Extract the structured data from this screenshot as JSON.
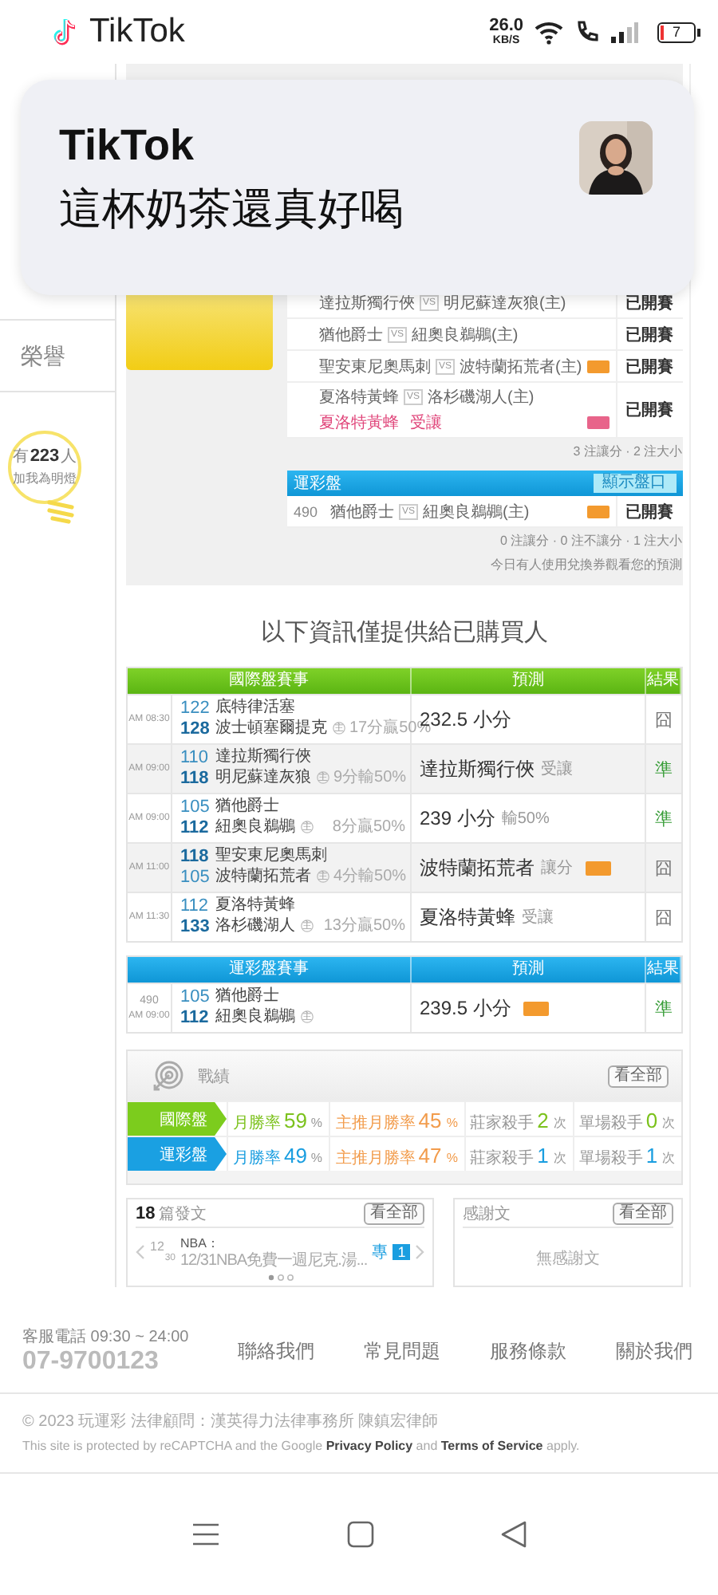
{
  "status_bar": {
    "app": "TikTok",
    "speed": "26.0",
    "speed_unit": "KB/S",
    "battery": "7"
  },
  "notification": {
    "title": "TikTok",
    "message": "這杯奶茶還真好喝"
  },
  "sidebar": {
    "items": [
      {
        "label": "榮譽"
      }
    ],
    "fans": {
      "prefix": "有",
      "count": "223",
      "suffix": "人",
      "caption": "加我為明燈"
    }
  },
  "picks": {
    "rows": [
      {
        "away": "達拉斯獨行俠",
        "vs": "VS",
        "home": "明尼蘇達灰狼(主)",
        "status": "已開賽"
      },
      {
        "away": "猶他爵士",
        "vs": "VS",
        "home": "紐奧良鵜鶘(主)",
        "status": "已開賽"
      },
      {
        "away": "聖安東尼奧馬刺",
        "vs": "VS",
        "home": "波特蘭拓荒者(主)",
        "badge": {
          "color": "#f39a2e"
        },
        "status": "已開賽"
      },
      {
        "away": "夏洛特黃蜂",
        "vs": "VS",
        "home": "洛杉磯湖人(主)",
        "pick": "夏洛特黃蜂",
        "pick_note": "受讓",
        "badge": {
          "color": "#e8648a"
        },
        "status": "已開賽"
      }
    ],
    "summary": "3 注讓分 · 2 注大小"
  },
  "lottery": {
    "title": "運彩盤",
    "button": "顯示盤口",
    "rows": [
      {
        "number": "490",
        "away": "猶他爵士",
        "vs": "VS",
        "home": "紐奧良鵜鶘(主)",
        "badge": {
          "color": "#f39a2e"
        },
        "status": "已開賽"
      }
    ],
    "summary": "0 注讓分 · 0 注不讓分 · 1 注大小",
    "note": "今日有人使用兌換券觀看您的預測"
  },
  "notice": "以下資訊僅提供給已購買人",
  "tables": [
    {
      "kind": "international",
      "columns": [
        "國際盤賽事",
        "預測",
        "結果"
      ],
      "rows": [
        {
          "time": "AM 08:30",
          "teams": [
            {
              "number": "122",
              "name": "底特律活塞",
              "strong": false
            },
            {
              "number": "128",
              "name": "波士頓塞爾提克",
              "home_mark": "主",
              "strong": true
            }
          ],
          "spread": "17分贏50%",
          "prediction": "232.5 小分",
          "result": "囧",
          "hit": false
        },
        {
          "time": "AM 09:00",
          "teams": [
            {
              "number": "110",
              "name": "達拉斯獨行俠",
              "strong": false
            },
            {
              "number": "118",
              "name": "明尼蘇達灰狼",
              "home_mark": "主",
              "strong": true
            }
          ],
          "spread": "9分輸50%",
          "prediction": "達拉斯獨行俠",
          "prediction_note": "受讓",
          "result": "準",
          "hit": true
        },
        {
          "time": "AM 09:00",
          "teams": [
            {
              "number": "105",
              "name": "猶他爵士",
              "strong": false
            },
            {
              "number": "112",
              "name": "紐奧良鵜鶘",
              "home_mark": "主",
              "strong": true
            }
          ],
          "spread": "8分贏50%",
          "prediction": "239 小分",
          "prediction_note": "輸50%",
          "result": "準",
          "hit": true
        },
        {
          "time": "AM 11:00",
          "teams": [
            {
              "number": "118",
              "name": "聖安東尼奧馬刺",
              "strong": true
            },
            {
              "number": "105",
              "name": "波特蘭拓荒者",
              "home_mark": "主",
              "strong": false
            }
          ],
          "spread": "4分輸50%",
          "prediction": "波特蘭拓荒者",
          "prediction_note": "讓分",
          "badge": {
            "color": "#f39a2e"
          },
          "result": "囧",
          "hit": false
        },
        {
          "time": "AM 11:30",
          "teams": [
            {
              "number": "112",
              "name": "夏洛特黃蜂",
              "strong": false
            },
            {
              "number": "133",
              "name": "洛杉磯湖人",
              "home_mark": "主",
              "strong": true
            }
          ],
          "spread": "13分贏50%",
          "prediction": "夏洛特黃蜂",
          "prediction_note": "受讓",
          "result": "囧",
          "hit": false
        }
      ]
    },
    {
      "kind": "lottery",
      "columns": [
        "運彩盤賽事",
        "預測",
        "結果"
      ],
      "rows": [
        {
          "number": "490",
          "time": "AM 09:00",
          "teams": [
            {
              "number": "105",
              "name": "猶他爵士",
              "strong": false
            },
            {
              "number": "112",
              "name": "紐奧良鵜鶘",
              "home_mark": "主",
              "strong": true
            }
          ],
          "prediction": "239.5 小分",
          "badge": {
            "color": "#f39a2e"
          },
          "result": "準",
          "hit": true
        }
      ]
    }
  ],
  "record": {
    "title": "戰績",
    "button": "看全部",
    "rows": [
      {
        "kind": "international",
        "label": "國際盤",
        "stats": [
          {
            "kind": "win",
            "label": "月勝率",
            "value": "59",
            "unit": "%"
          },
          {
            "kind": "main",
            "label": "主推月勝率",
            "value": "45",
            "unit": "%"
          },
          {
            "kind": "killer",
            "label": "莊家殺手",
            "value": "2",
            "unit": "次"
          },
          {
            "kind": "killer",
            "label": "單場殺手",
            "value": "0",
            "unit": "次"
          }
        ]
      },
      {
        "kind": "lottery",
        "label": "運彩盤",
        "stats": [
          {
            "kind": "win",
            "label": "月勝率",
            "value": "49",
            "unit": "%"
          },
          {
            "kind": "main",
            "label": "主推月勝率",
            "value": "47",
            "unit": "%"
          },
          {
            "kind": "killer",
            "label": "莊家殺手",
            "value": "1",
            "unit": "次"
          },
          {
            "kind": "killer",
            "label": "單場殺手",
            "value": "1",
            "unit": "次"
          }
        ]
      }
    ]
  },
  "posts": {
    "count": "18",
    "label": "篇發文",
    "button": "看全部",
    "items": [
      {
        "month": "12",
        "day": "30",
        "category": "NBA：",
        "title": "12/31NBA免費一週尼克.湯...",
        "tag": "專",
        "rank": "1"
      }
    ]
  },
  "thanks": {
    "title": "感謝文",
    "button": "看全部",
    "empty": "無感謝文"
  },
  "footer": {
    "hours": "客服電話 09:30 ~ 24:00",
    "phone": "07-9700123",
    "links": [
      "聯絡我們",
      "常見問題",
      "服務條款",
      "關於我們"
    ],
    "copyright": "© 2023 玩運彩 法律顧問：漢英得力法律事務所 陳鎮宏律師",
    "recaptcha": "This site is protected by reCAPTCHA and the Google **Privacy Policy** and **Terms of Service** apply."
  }
}
